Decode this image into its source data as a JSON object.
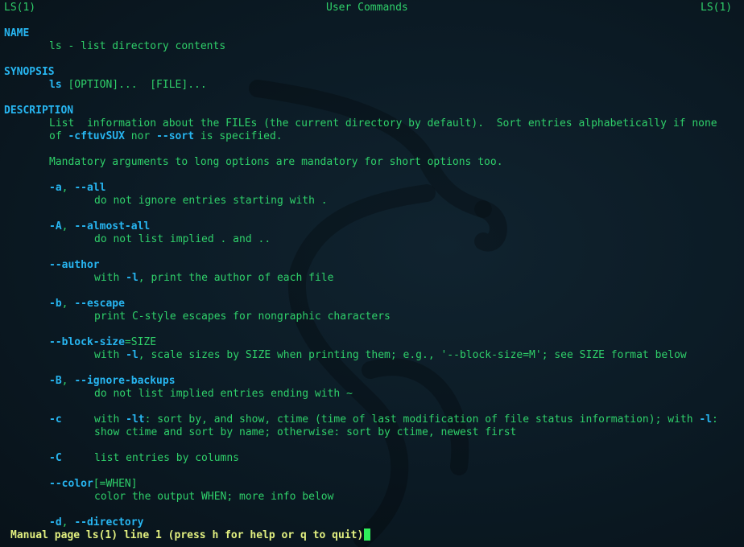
{
  "header": {
    "left": "LS(1)",
    "center": "User Commands",
    "right": "LS(1)"
  },
  "name": {
    "heading": "NAME",
    "text": "ls - list directory contents"
  },
  "synopsis": {
    "heading": "SYNOPSIS",
    "cmd": "ls",
    "args": "[OPTION]...  [FILE]..."
  },
  "description": {
    "heading": "DESCRIPTION",
    "line1": "List  information about the FILEs (the current directory by default).  Sort entries alphabetically if none",
    "line2_pre": "of ",
    "line2_opt1": "-cftuvSUX",
    "line2_mid": " nor ",
    "line2_opt2": "--sort",
    "line2_post": " is specified.",
    "mandatory": "Mandatory arguments to long options are mandatory for short options too."
  },
  "options": {
    "a_short": "-a",
    "a_long": "--all",
    "a_desc": "do not ignore entries starting with .",
    "A_short": "-A",
    "A_long": "--almost-all",
    "A_desc": "do not list implied . and ..",
    "author_long": "--author",
    "author_desc_pre": "with ",
    "author_desc_opt": "-l",
    "author_desc_post": ", print the author of each file",
    "b_short": "-b",
    "b_long": "--escape",
    "b_desc": "print C-style escapes for nongraphic characters",
    "bs_long": "--block-size",
    "bs_arg": "=SIZE",
    "bs_desc_pre": "with ",
    "bs_desc_opt": "-l",
    "bs_desc_post": ", scale sizes by SIZE when printing them; e.g., '--block-size=M'; see SIZE format below",
    "B_short": "-B",
    "B_long": "--ignore-backups",
    "B_desc": "do not list implied entries ending with ~",
    "c_short": "-c",
    "c_desc1_pre": "with ",
    "c_desc1_opt": "-lt",
    "c_desc1_mid": ": sort by, and show, ctime (time of last modification of file status information); with ",
    "c_desc1_opt2": "-l",
    "c_desc1_post": ":",
    "c_desc2": "show ctime and sort by name; otherwise: sort by ctime, newest first",
    "C_short": "-C",
    "C_desc": "list entries by columns",
    "color_long": "--color",
    "color_arg": "[=WHEN]",
    "color_desc": "color the output WHEN; more info below",
    "d_short": "-d",
    "d_long": "--directory"
  },
  "status": {
    "text": "Manual page ls(1) line 1 (press h for help or q to quit)"
  },
  "colors": {
    "background": "#0b1a24",
    "text": "#2fd06a",
    "bold": "#27b5f0",
    "status": "#e2f080",
    "cursor": "#2ef05a"
  }
}
